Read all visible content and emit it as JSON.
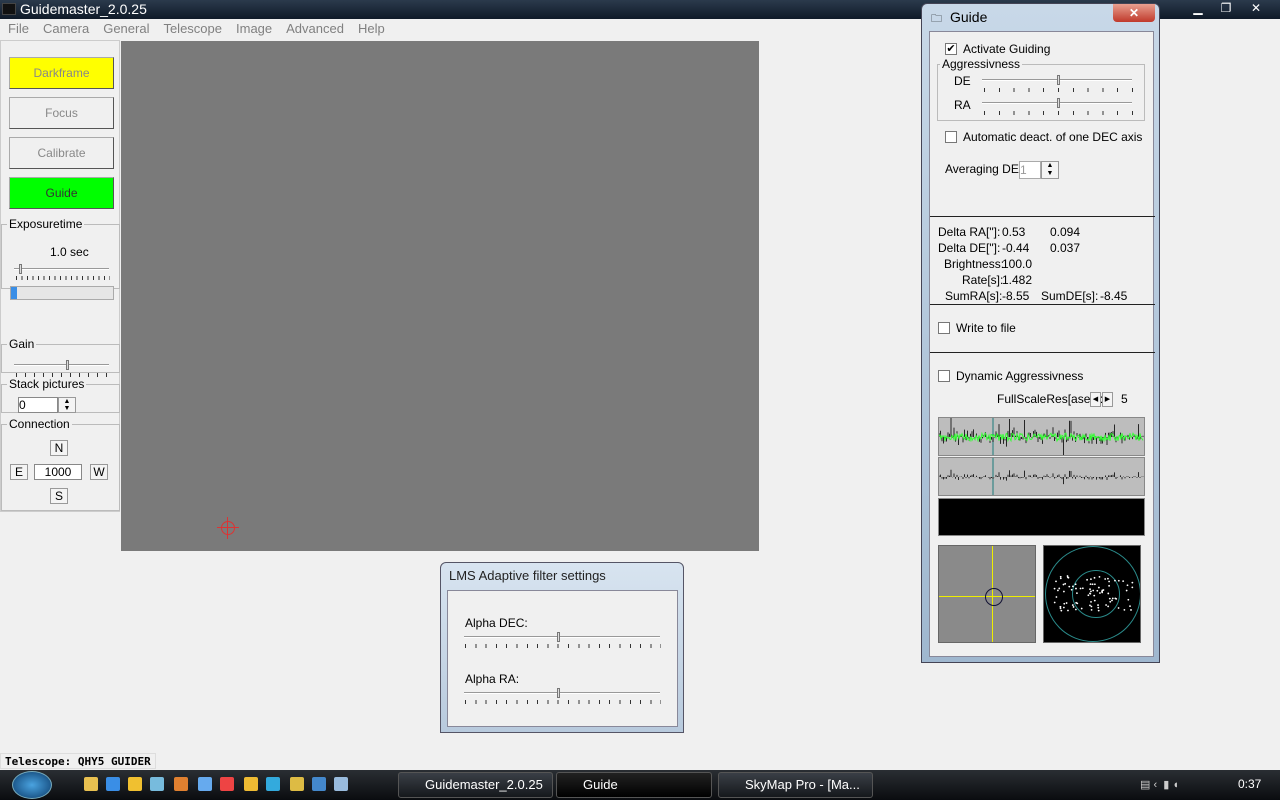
{
  "app": {
    "title": "Guidemaster_2.0.25"
  },
  "menu": [
    "File",
    "Camera",
    "General",
    "Telescope",
    "Image",
    "Advanced",
    "Help"
  ],
  "left": {
    "buttons": [
      {
        "label": "Darkframe",
        "color": "#ffff00"
      },
      {
        "label": "Focus",
        "color": "#f0f0f0"
      },
      {
        "label": "Calibrate",
        "color": "#f0f0f0"
      },
      {
        "label": "Guide",
        "color": "#00ff00"
      }
    ],
    "exposure": {
      "legend": "Exposuretime",
      "value": "1.0 sec",
      "slider_fraction": 0.05,
      "progress_fraction": 0.06
    },
    "gain": {
      "legend": "Gain",
      "slider_fraction": 0.55
    },
    "stack": {
      "legend": "Stack pictures",
      "value": "0"
    },
    "connection": {
      "legend": "Connection",
      "n": "N",
      "e": "E",
      "w": "W",
      "s": "S",
      "value": "1000"
    }
  },
  "guide": {
    "title": "Guide",
    "activate": {
      "label": "Activate Guiding",
      "checked": true
    },
    "aggr": {
      "legend": "Aggressivness",
      "de": "DE",
      "ra": "RA",
      "de_fraction": 0.5,
      "ra_fraction": 0.5
    },
    "autodeact": {
      "label": "Automatic deact. of one DEC axis",
      "checked": false
    },
    "averaging": {
      "label": "Averaging DE:",
      "value": "1"
    },
    "stats": {
      "delta_ra_label": "Delta RA[\"]:",
      "delta_ra": "0.53",
      "delta_ra2": "0.094",
      "delta_de_label": "Delta DE[\"]:",
      "delta_de": "-0.44",
      "delta_de2": "0.037",
      "brightness_label": "Brightness:",
      "brightness": "100.0",
      "rate_label": "Rate[s]:",
      "rate": "1.482",
      "sumra_label": "SumRA[s]:",
      "sumra": "-8.55",
      "sumde_label": "SumDE[s]:",
      "sumde": "-8.45"
    },
    "write": {
      "label": "Write to file",
      "checked": false
    },
    "dynamic": {
      "label": "Dynamic Aggressivness",
      "checked": false
    },
    "fullscale": {
      "label": "FullScaleRes[asec]:",
      "value": "5"
    }
  },
  "lms": {
    "title": "LMS Adaptive filter settings",
    "alpha_dec": "Alpha DEC:",
    "alpha_ra": "Alpha RA:",
    "dec_fraction": 0.5,
    "ra_fraction": 0.5
  },
  "status": "Telescope: QHY5 GUIDER",
  "taskbar": {
    "tasks": [
      "Guidemaster_2.0.25",
      "Guide",
      "SkyMap Pro - [Ma..."
    ],
    "clock": "0:37"
  }
}
